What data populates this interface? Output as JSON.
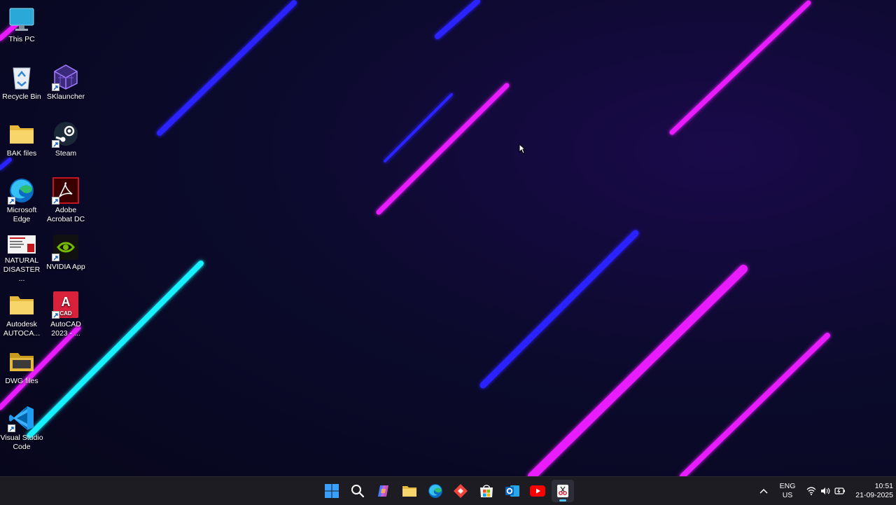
{
  "desktop": {
    "icons": [
      {
        "id": "this-pc",
        "label": "This PC"
      },
      {
        "id": "recycle-bin",
        "label": "Recycle Bin"
      },
      {
        "id": "sklauncher",
        "label": "SKlauncher"
      },
      {
        "id": "bak-files",
        "label": "BAK files"
      },
      {
        "id": "steam",
        "label": "Steam"
      },
      {
        "id": "microsoft-edge",
        "label": "Microsoft Edge"
      },
      {
        "id": "adobe-acrobat",
        "label": "Adobe Acrobat DC"
      },
      {
        "id": "natural-disaster",
        "label": "NATURAL DISASTER ..."
      },
      {
        "id": "nvidia-app",
        "label": "NVIDIA App"
      },
      {
        "id": "autodesk-autoca",
        "label": "Autodesk AUTOCA..."
      },
      {
        "id": "autocad-2023",
        "label": "AutoCAD 2023 - ..."
      },
      {
        "id": "dwg-files",
        "label": "DWG files"
      },
      {
        "id": "vscode",
        "label": "Visual Studio Code"
      }
    ]
  },
  "taskbar": {
    "apps": [
      {
        "id": "start",
        "icon": "windows-start-icon"
      },
      {
        "id": "search",
        "icon": "search-icon"
      },
      {
        "id": "copilot",
        "icon": "copilot-icon"
      },
      {
        "id": "file-explorer",
        "icon": "folder-icon"
      },
      {
        "id": "edge",
        "icon": "edge-icon"
      },
      {
        "id": "anydesk",
        "icon": "anydesk-icon"
      },
      {
        "id": "store",
        "icon": "store-icon"
      },
      {
        "id": "outlook",
        "icon": "outlook-icon"
      },
      {
        "id": "youtube",
        "icon": "youtube-icon"
      },
      {
        "id": "snipping-tool",
        "icon": "snipping-tool-icon",
        "active": true
      }
    ],
    "tray": {
      "lang_line1": "ENG",
      "lang_line2": "US",
      "time": "10:51",
      "date": "21-09-2025"
    }
  },
  "colors": {
    "accent": "#4cc2ff",
    "streak_magenta": "#e81cff",
    "streak_blue": "#2a22ff",
    "streak_cyan": "#14f0ff",
    "taskbar_bg": "#1c1c22"
  }
}
